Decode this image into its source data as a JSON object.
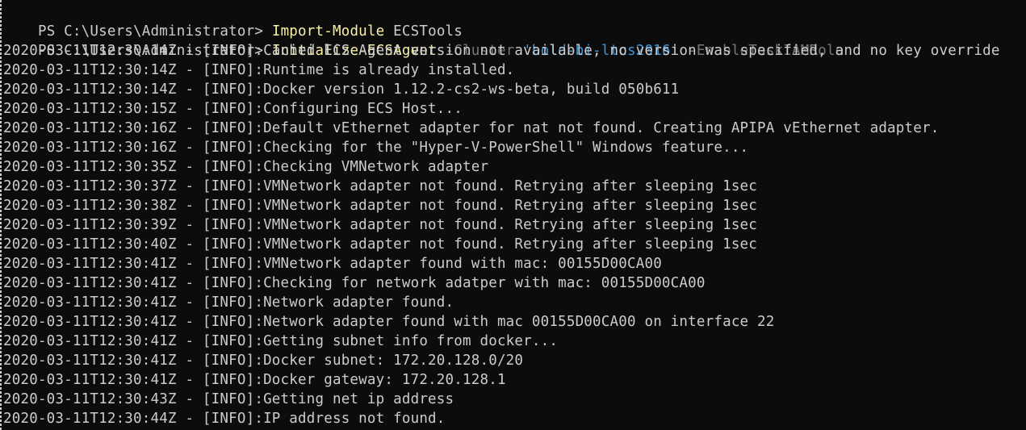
{
  "prompts": [
    {
      "prompt": "PS C:\\Users\\Administrator> ",
      "command": "Import-Module",
      "parts": [
        {
          "text": " ECSTools",
          "kind": "arg"
        }
      ]
    },
    {
      "prompt": "PS C:\\Users\\Administrator> ",
      "command": "Initialize-ECSAgent",
      "parts": [
        {
          "text": " -Cluster",
          "kind": "param"
        },
        {
          "text": " 'bold-bi-ltcs2016'",
          "kind": "str"
        },
        {
          "text": " -EnableTaskIAMRole",
          "kind": "param"
        }
      ]
    }
  ],
  "log_lines": [
    "2020-03-11T12:30:14Z - [INFO]:Cached ECS Agent version not available, no version was specified, and no key override",
    "2020-03-11T12:30:14Z - [INFO]:Runtime is already installed.",
    "2020-03-11T12:30:14Z - [INFO]:Docker version 1.12.2-cs2-ws-beta, build 050b611",
    "2020-03-11T12:30:15Z - [INFO]:Configuring ECS Host...",
    "2020-03-11T12:30:16Z - [INFO]:Default vEthernet adapter for nat not found. Creating APIPA vEthernet adapter.",
    "2020-03-11T12:30:16Z - [INFO]:Checking for the \"Hyper-V-PowerShell\" Windows feature...",
    "2020-03-11T12:30:35Z - [INFO]:Checking VMNetwork adapter",
    "2020-03-11T12:30:37Z - [INFO]:VMNetwork adapter not found. Retrying after sleeping 1sec",
    "2020-03-11T12:30:38Z - [INFO]:VMNetwork adapter not found. Retrying after sleeping 1sec",
    "2020-03-11T12:30:39Z - [INFO]:VMNetwork adapter not found. Retrying after sleeping 1sec",
    "2020-03-11T12:30:40Z - [INFO]:VMNetwork adapter not found. Retrying after sleeping 1sec",
    "2020-03-11T12:30:41Z - [INFO]:VMNetwork adapter found with mac: 00155D00CA00",
    "2020-03-11T12:30:41Z - [INFO]:Checking for network adatper with mac: 00155D00CA00",
    "2020-03-11T12:30:41Z - [INFO]:Network adapter found.",
    "2020-03-11T12:30:41Z - [INFO]:Network adapter found with mac 00155D00CA00 on interface 22",
    "2020-03-11T12:30:41Z - [INFO]:Getting subnet info from docker...",
    "2020-03-11T12:30:41Z - [INFO]:Docker subnet: 172.20.128.0/20",
    "2020-03-11T12:30:41Z - [INFO]:Docker gateway: 172.20.128.1",
    "2020-03-11T12:30:43Z - [INFO]:Getting net ip address",
    "2020-03-11T12:30:44Z - [INFO]:IP address not found."
  ],
  "colors": {
    "background": "#0c0c0c",
    "text": "#cccccc",
    "command": "#f9f1a5",
    "parameter": "#767676",
    "string": "#3a96dd"
  }
}
